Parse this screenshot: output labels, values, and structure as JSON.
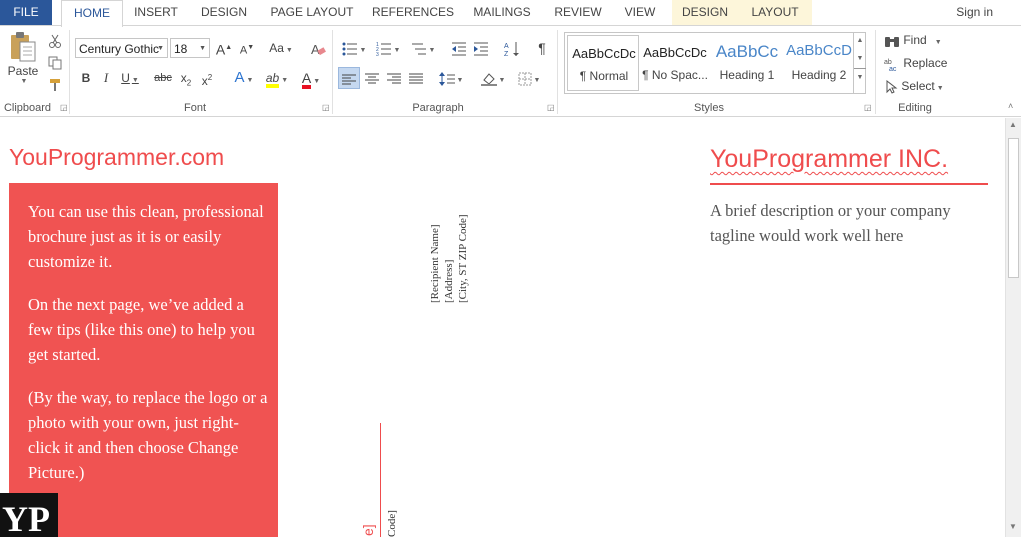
{
  "tabs": {
    "file": "FILE",
    "home": "HOME",
    "insert": "INSERT",
    "design": "DESIGN",
    "page_layout": "PAGE LAYOUT",
    "references": "REFERENCES",
    "mailings": "MAILINGS",
    "review": "REVIEW",
    "view": "VIEW",
    "ctx_design": "DESIGN",
    "ctx_layout": "LAYOUT"
  },
  "signin": "Sign in",
  "ribbon": {
    "clipboard": {
      "label": "Clipboard",
      "paste": "Paste"
    },
    "font": {
      "label": "Font",
      "font_name": "Century Gothic",
      "font_size": "18",
      "bold": "B",
      "italic": "I",
      "underline": "U",
      "strike": "abc",
      "subscript": "x",
      "subscript_sup": "2",
      "superscript": "x",
      "superscript_sup": "2",
      "grow": "A",
      "shrink": "A",
      "case": "Aa",
      "text_effects": "A",
      "highlight": "ab",
      "font_color": "A",
      "highlight_color": "#ffff00",
      "font_color_value": "#e81123"
    },
    "paragraph": {
      "label": "Paragraph",
      "pilcrow": "¶"
    },
    "styles": {
      "label": "Styles",
      "items": [
        {
          "sample": "AaBbCcDc",
          "name": "¶ Normal"
        },
        {
          "sample": "AaBbCcDc",
          "name": "¶ No Spac..."
        },
        {
          "sample": "AaBbCc",
          "name": "Heading 1"
        },
        {
          "sample": "AaBbCcD",
          "name": "Heading 2"
        }
      ]
    },
    "editing": {
      "label": "Editing",
      "find": "Find",
      "replace": "Replace",
      "select": "Select"
    }
  },
  "document": {
    "site_title": "YouProgrammer.com",
    "panel_paragraphs": [
      "You can use this clean, professional brochure just as it is or easily customize it.",
      "On the next page, we’ve added a few tips (like this one) to help you get started.",
      "(By the way, to replace the logo or a photo with your own, just right-click it and then choose Change Picture.)"
    ],
    "address_lines": [
      "[Recipient Name]",
      "[Address]",
      "[City, ST  ZIP Code]"
    ],
    "fragment_e": "e]",
    "fragment_code": "Code]",
    "company_name": "YouProgrammer INC.",
    "tagline": "A brief description or your company tagline would work well here",
    "logo_text": "YP",
    "accent_color": "#f05352"
  }
}
